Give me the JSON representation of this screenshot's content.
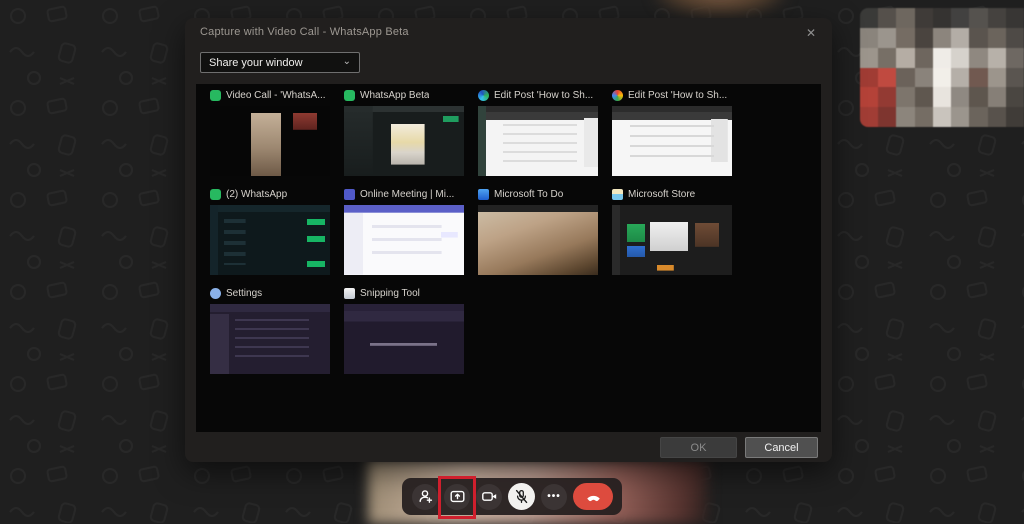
{
  "dialog": {
    "title": "Capture with Video Call - WhatsApp Beta",
    "close_glyph": "✕",
    "share_dropdown": {
      "value": "Share your window",
      "chevron": "⌄"
    },
    "windows": [
      {
        "label": "Video Call - 'WhatsA...",
        "icon": "whatsapp",
        "scene": "wa-call"
      },
      {
        "label": "WhatsApp Beta",
        "icon": "whatsapp",
        "scene": "wa-beta"
      },
      {
        "label": "Edit Post 'How to Sh...",
        "icon": "edge",
        "scene": "browser"
      },
      {
        "label": "Edit Post 'How to Sh...",
        "icon": "chrome",
        "scene": "browser2"
      },
      {
        "label": "(2) WhatsApp",
        "icon": "whatsapp",
        "scene": "wa-dark"
      },
      {
        "label": "Online Meeting | Mi...",
        "icon": "teams",
        "scene": "teams"
      },
      {
        "label": "Microsoft To Do",
        "icon": "todo",
        "scene": "todo"
      },
      {
        "label": "Microsoft Store",
        "icon": "store",
        "scene": "store"
      },
      {
        "label": "Settings",
        "icon": "settings",
        "scene": "settings"
      },
      {
        "label": "Snipping Tool",
        "icon": "snip",
        "scene": "snip"
      }
    ],
    "ok_label": "OK",
    "cancel_label": "Cancel"
  },
  "call_controls": {
    "more_glyph": "•••",
    "buttons": [
      {
        "name": "add-person"
      },
      {
        "name": "share-screen",
        "highlighted": true
      },
      {
        "name": "camera"
      },
      {
        "name": "microphone-muted",
        "active": true
      },
      {
        "name": "more-options"
      },
      {
        "name": "end-call"
      }
    ],
    "highlight_color": "#cf1f2d",
    "end_call_color": "#dd4b3e"
  },
  "colors": {
    "whatsapp_green": "#27b960",
    "dialog_bg": "#211f1e",
    "panel_bg": "#070707",
    "page_bg": "#1f1f1f"
  },
  "webcam_mosaic": [
    [
      "#3a3a38",
      "#55504b",
      "#6e675f",
      "#3f3b38",
      "#353331",
      "#424140",
      "#55524e",
      "#45423f",
      "#383634"
    ],
    [
      "#8a847c",
      "#9b958d",
      "#756c63",
      "#4a443f",
      "#8c857d",
      "#b3ada6",
      "#5a544e",
      "#6b645c",
      "#4e4a46"
    ],
    [
      "#9c958c",
      "#776f66",
      "#b5ada4",
      "#6e665e",
      "#efece7",
      "#d6d2cc",
      "#8f8880",
      "#b7b1a9",
      "#6e6862"
    ],
    [
      "#a03c34",
      "#c04a40",
      "#6b625a",
      "#8a837b",
      "#f2efe9",
      "#b5afa8",
      "#715950",
      "#9c958c",
      "#5a5550"
    ],
    [
      "#b44238",
      "#933a33",
      "#7d756c",
      "#5f574f",
      "#e8e4de",
      "#8f8982",
      "#5e564e",
      "#867f77",
      "#4a4641"
    ],
    [
      "#a13d35",
      "#7e352f",
      "#8c857c",
      "#756d64",
      "#c9c4bd",
      "#9b958d",
      "#6b645c",
      "#58524c",
      "#403c38"
    ]
  ]
}
